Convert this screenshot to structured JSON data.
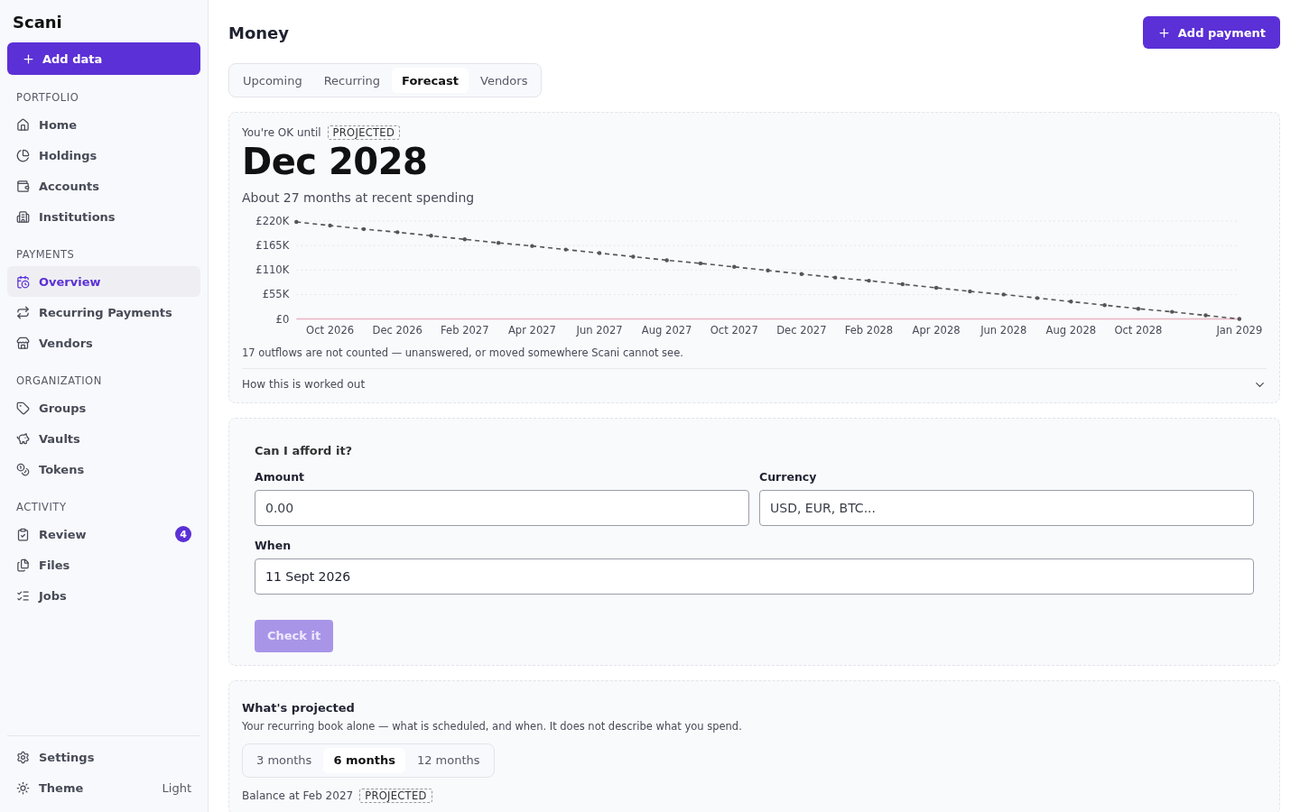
{
  "sidebar": {
    "brand": "Scani",
    "add_button": "Add data",
    "sections": [
      {
        "heading": "PORTFOLIO",
        "items": [
          {
            "label": "Home",
            "selected": false
          },
          {
            "label": "Holdings",
            "selected": false
          },
          {
            "label": "Accounts",
            "selected": false
          },
          {
            "label": "Institutions",
            "selected": false
          }
        ]
      },
      {
        "heading": "PAYMENTS",
        "items": [
          {
            "label": "Overview",
            "selected": true
          },
          {
            "label": "Recurring Payments",
            "selected": false
          },
          {
            "label": "Vendors",
            "selected": false
          }
        ]
      },
      {
        "heading": "ORGANIZATION",
        "items": [
          {
            "label": "Groups",
            "selected": false
          },
          {
            "label": "Vaults",
            "selected": false
          },
          {
            "label": "Tokens",
            "selected": false
          }
        ]
      },
      {
        "heading": "ACTIVITY",
        "items": [
          {
            "label": "Review",
            "selected": false,
            "badge": "4"
          },
          {
            "label": "Files",
            "selected": false
          },
          {
            "label": "Jobs",
            "selected": false
          }
        ]
      }
    ],
    "footer": {
      "settings": "Settings",
      "theme": "Theme",
      "theme_value": "Light"
    }
  },
  "header": {
    "title": "Money",
    "add_button": "Add payment"
  },
  "tabs": [
    {
      "label": "Upcoming",
      "selected": false
    },
    {
      "label": "Recurring",
      "selected": false
    },
    {
      "label": "Forecast",
      "selected": true
    },
    {
      "label": "Vendors",
      "selected": false
    }
  ],
  "runway": {
    "intro": "You're OK until",
    "badge": "PROJECTED",
    "date": "Dec 2028",
    "subtitle": "About 27 months at recent spending",
    "chart_data": {
      "type": "line",
      "grid": true,
      "ylim": [
        0,
        220000
      ],
      "yticks": [
        {
          "value": 0,
          "label": "£0"
        },
        {
          "value": 55000,
          "label": "£55K"
        },
        {
          "value": 110000,
          "label": "£110K"
        },
        {
          "value": 165000,
          "label": "£165K"
        },
        {
          "value": 220000,
          "label": "£220K"
        }
      ],
      "categories": [
        null,
        "Oct 2026",
        null,
        "Dec 2026",
        null,
        "Feb 2027",
        null,
        "Apr 2027",
        null,
        "Jun 2027",
        null,
        "Aug 2027",
        null,
        "Oct 2027",
        null,
        "Dec 2027",
        null,
        "Feb 2028",
        null,
        "Apr 2028",
        null,
        "Jun 2028",
        null,
        "Aug 2028",
        null,
        "Oct 2028",
        null,
        null,
        "Jan 2029"
      ],
      "series": [
        {
          "color": "#555555",
          "line_style": "dashed",
          "values": [
            218000,
            210000,
            202000,
            195000,
            187000,
            179000,
            171000,
            164000,
            156000,
            148000,
            140000,
            132000,
            125000,
            117000,
            109000,
            101000,
            93000,
            86000,
            78000,
            70000,
            62000,
            55000,
            47000,
            39000,
            31000,
            23000,
            16000,
            8000,
            0
          ]
        }
      ]
    },
    "note": "17 outflows are not counted — unanswered, or moved somewhere Scani cannot see.",
    "details": {
      "label": "How this is worked out",
      "expanded": false
    }
  },
  "afford": {
    "title": "Can I afford it?",
    "fields": [
      {
        "label": "Amount",
        "placeholder": "0.00"
      },
      {
        "label": "Currency",
        "placeholder": "USD, EUR, BTC..."
      },
      {
        "label": "When",
        "value": "11 Sept 2026"
      }
    ],
    "button": {
      "label": "Check it",
      "disabled": true
    }
  },
  "projected": {
    "title": "What's projected",
    "description": "Your recurring book alone — what is scheduled, and when. It does not describe what you spend.",
    "ranges": [
      {
        "label": "3 months",
        "selected": false
      },
      {
        "label": "6 months",
        "selected": true
      },
      {
        "label": "12 months",
        "selected": false
      }
    ],
    "balance_label": "Balance at Feb 2027",
    "badge": "PROJECTED"
  }
}
